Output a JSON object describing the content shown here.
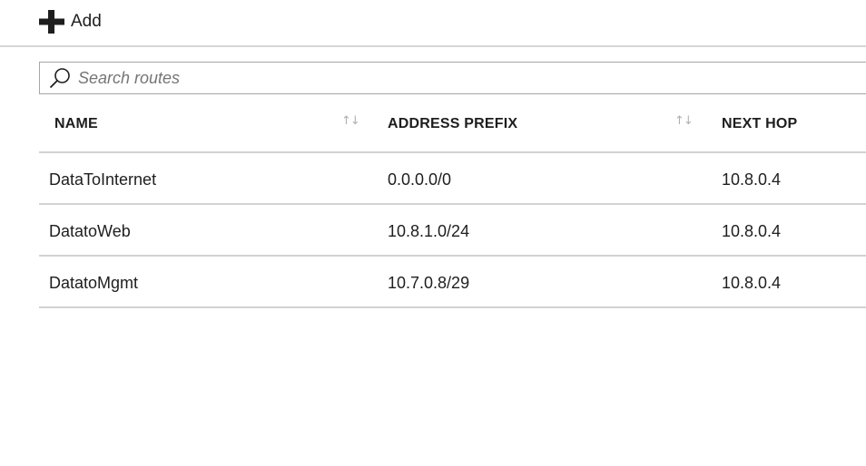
{
  "toolbar": {
    "add_label": "Add"
  },
  "search": {
    "placeholder": "Search routes"
  },
  "table": {
    "columns": [
      {
        "label": "NAME",
        "sortable": true
      },
      {
        "label": "ADDRESS PREFIX",
        "sortable": true
      },
      {
        "label": "NEXT HOP",
        "sortable": false
      }
    ],
    "sort_glyph": "↑↓",
    "rows": [
      {
        "name": "DataToInternet",
        "address_prefix": "0.0.0.0/0",
        "next_hop": "10.8.0.4"
      },
      {
        "name": "DatatoWeb",
        "address_prefix": "10.8.1.0/24",
        "next_hop": "10.8.0.4"
      },
      {
        "name": "DatatoMgmt",
        "address_prefix": "10.7.0.8/29",
        "next_hop": "10.8.0.4"
      }
    ]
  },
  "colors": {
    "text": "#1e1e1e",
    "divider": "#d2d2d2",
    "search_border": "#a6a6a6",
    "sort_icon": "#b0b0b0"
  }
}
